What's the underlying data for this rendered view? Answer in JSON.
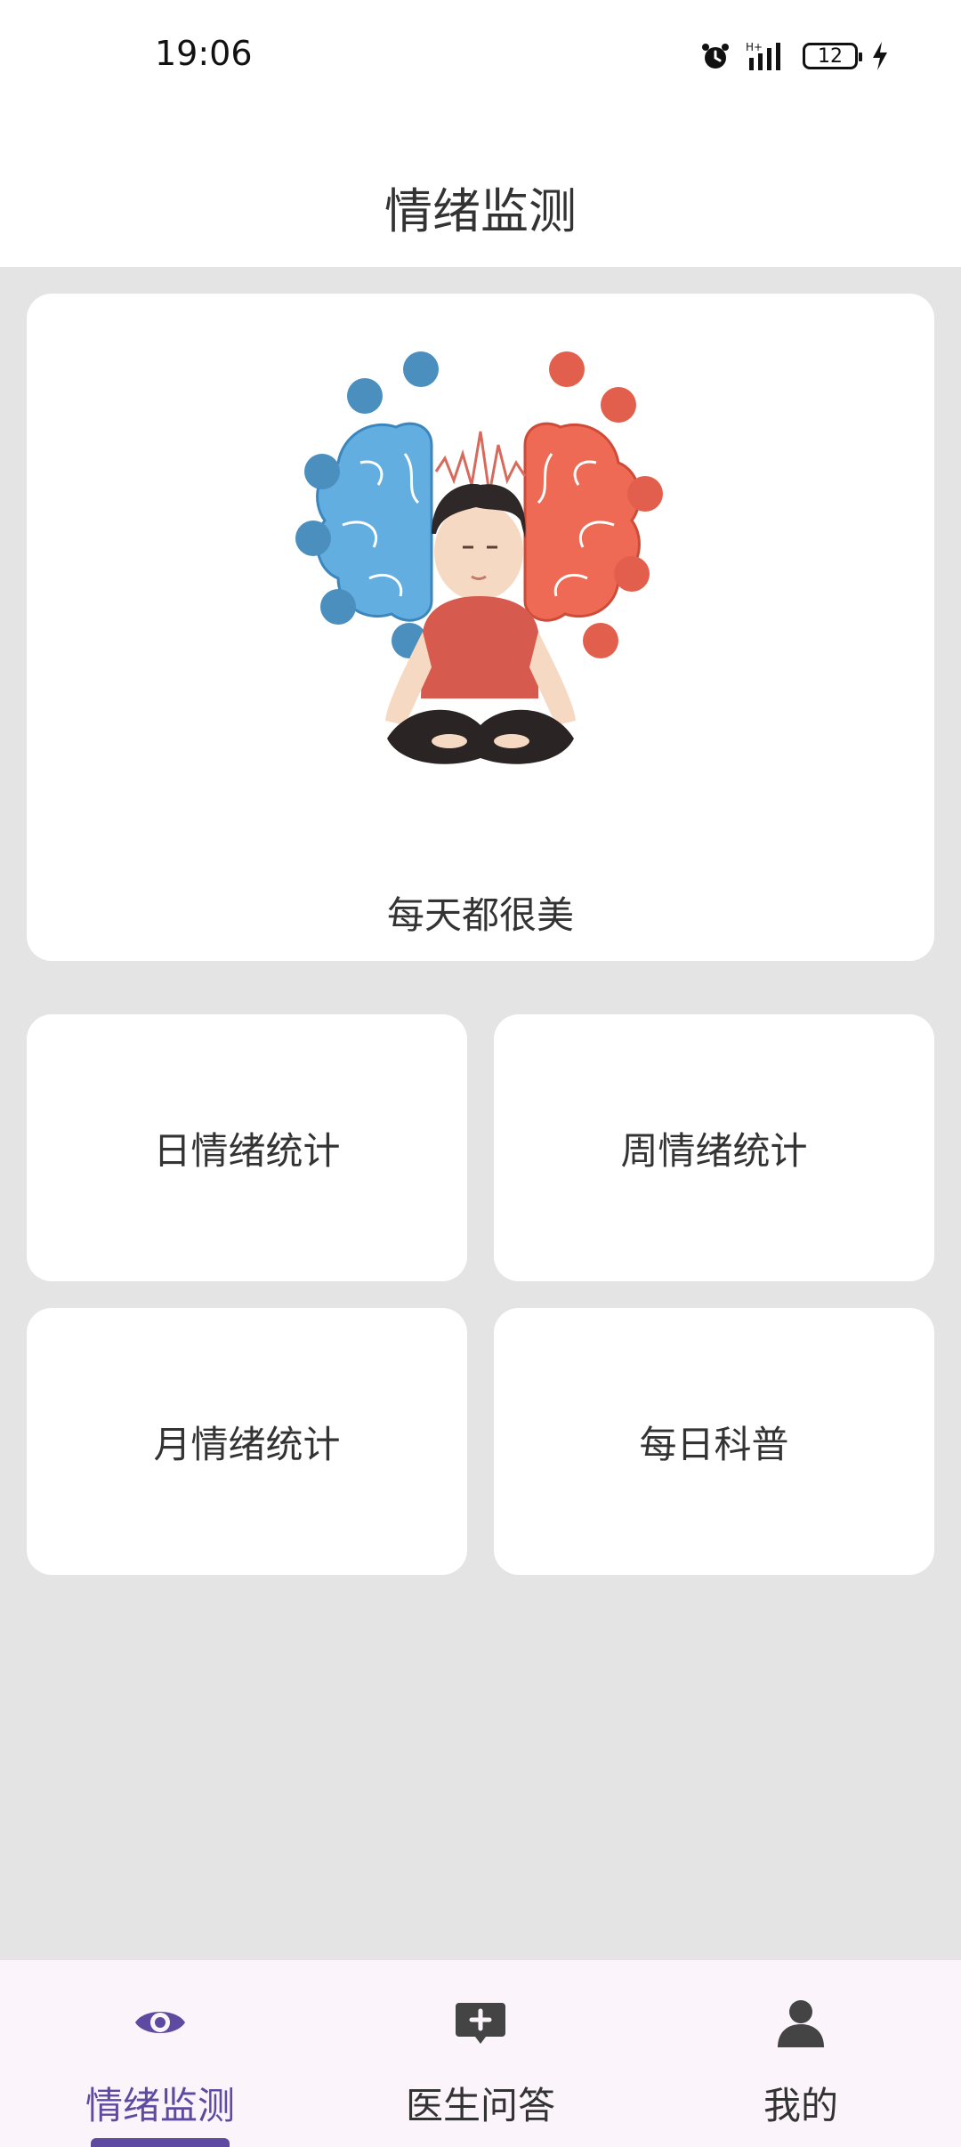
{
  "status_bar": {
    "time": "19:06",
    "battery": "12",
    "icons": [
      "alarm-icon",
      "signal-icon",
      "battery-icon",
      "charging-icon"
    ]
  },
  "header": {
    "title": "情绪监测"
  },
  "banner": {
    "caption": "每天都很美",
    "image": "meditation-illustration"
  },
  "tiles": [
    {
      "label": "日情绪统计"
    },
    {
      "label": "周情绪统计"
    },
    {
      "label": "月情绪统计"
    },
    {
      "label": "每日科普"
    }
  ],
  "bottom_nav": {
    "items": [
      {
        "label": "情绪监测",
        "icon": "eye-icon",
        "active": true
      },
      {
        "label": "医生问答",
        "icon": "chat-plus-icon",
        "active": false
      },
      {
        "label": "我的",
        "icon": "person-icon",
        "active": false
      }
    ],
    "accent": "#5e4aa0"
  },
  "colors": {
    "background": "#e4e4e4",
    "card": "#ffffff",
    "nav_background": "#fbf4fb"
  }
}
